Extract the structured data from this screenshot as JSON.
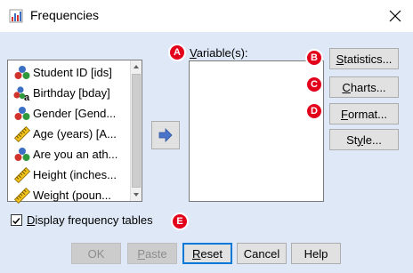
{
  "window": {
    "title": "Frequencies",
    "close_glyph": "✕"
  },
  "source_list": {
    "items": [
      {
        "label": "Student ID [ids]",
        "icon": "nominal-measure-icon"
      },
      {
        "label": "Birthday [bday]",
        "icon": "nominal-string-measure-icon"
      },
      {
        "label": "Gender [Gend...",
        "icon": "nominal-measure-icon"
      },
      {
        "label": "Age (years) [A...",
        "icon": "scale-ruler-icon"
      },
      {
        "label": "Are you an ath...",
        "icon": "nominal-measure-icon"
      },
      {
        "label": "Height (inches...",
        "icon": "scale-ruler-icon"
      },
      {
        "label": "Weight (poun...",
        "icon": "scale-ruler-icon"
      }
    ]
  },
  "target": {
    "label": "Variable(s):",
    "label_underline": "V",
    "label_rest": "ariable(s):"
  },
  "side_buttons": [
    {
      "id": "statistics",
      "label_u": "S",
      "label_rest": "tatistics...",
      "badge": "B"
    },
    {
      "id": "charts",
      "label_u": "C",
      "label_rest": "harts...",
      "badge": "C"
    },
    {
      "id": "format",
      "label_u": "F",
      "label_rest": "ormat...",
      "badge": "D"
    },
    {
      "id": "style",
      "label_pre": "St",
      "label_u": "y",
      "label_rest": "le...",
      "badge": ""
    }
  ],
  "badges": {
    "variables": "A",
    "display_freq": "E"
  },
  "display_freq": {
    "label_u": "D",
    "label_rest": "isplay frequency tables",
    "checked": true
  },
  "bottom_buttons": {
    "ok": "OK",
    "paste_u": "P",
    "paste_rest": "aste",
    "reset_u": "R",
    "reset_rest": "eset",
    "cancel": "Cancel",
    "help": "Help"
  },
  "colors": {
    "dialog_bg": "#dfe8f6",
    "badge_red": "#e2001a",
    "focus_blue": "#0078d7"
  }
}
